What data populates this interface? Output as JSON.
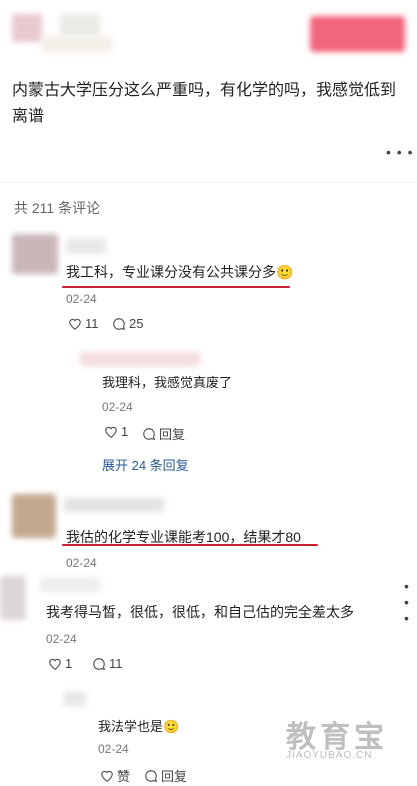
{
  "post": {
    "text": "内蒙古大学压分这么严重吗，有化学的吗，我感觉低到离谱",
    "more": "• • •"
  },
  "comments_count": "共 211 条评论",
  "comments": [
    {
      "text": "我工科，专业课分没有公共课分多🙂",
      "date": "02-24",
      "likes": "11",
      "replies": "25",
      "reply": {
        "text": "我理科，我感觉真废了",
        "date": "02-24",
        "likes": "1",
        "reply_label": "回复"
      },
      "expand": "展开 24 条回复"
    },
    {
      "text": "我估的化学专业课能考100，结果才80",
      "date": "02-24"
    },
    {
      "text": "我考得马皙，很低，很低，和自己估的完全差太多",
      "date": "02-24",
      "likes": "1",
      "replies": "11",
      "reply": {
        "text": "我法学也是🙂",
        "date": "02-24",
        "like_label": "赞",
        "reply_label": "回复"
      }
    }
  ],
  "watermark": {
    "title": "教育宝",
    "url": "JIAOYUBAO.CN"
  },
  "colors": {
    "underline": "#c8202e",
    "link": "#2a5a9a"
  }
}
